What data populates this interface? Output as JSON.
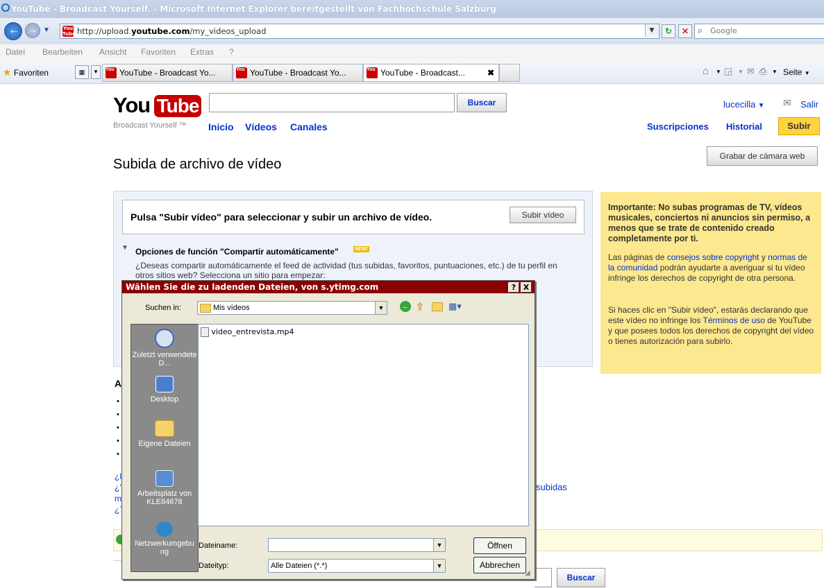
{
  "browser": {
    "title": "YouTube - Broadcast Yourself. - Microsoft Internet Explorer bereitgestellt von Fachhochschule Salzburg",
    "url_prefix": "http://upload.",
    "url_domain": "youtube.com",
    "url_path": "/my_videos_upload",
    "search_placeholder": "Google",
    "menu": [
      "Datei",
      "Bearbeiten",
      "Ansicht",
      "Favoriten",
      "Extras",
      "?"
    ],
    "favorites_label": "Favoriten",
    "tabs": [
      "YouTube - Broadcast Yo...",
      "YouTube - Broadcast Yo...",
      "YouTube - Broadcast..."
    ],
    "tools_page": "Seite"
  },
  "youtube": {
    "logo_you": "You",
    "logo_tube": "Tube",
    "tagline": "Broadcast Yourself ™",
    "search_button": "Buscar",
    "nav": [
      "Inicio",
      "Vídeos",
      "Canales"
    ],
    "user": "lucecilla",
    "logout": "Salir",
    "subscriptions": "Suscripciones",
    "history": "Historial",
    "upload": "Subir",
    "webcam_button": "Grabar de cámara web",
    "page_title": "Subida de archivo de vídeo",
    "upload_prompt": "Pulsa \"Subir vídeo\" para seleccionar y subir un archivo de vídeo.",
    "upload_button": "Subir vídeo",
    "autoshare_title": "Opciones de función \"Compartir automáticamente\"",
    "new_badge": "NEW!",
    "autoshare_text": "¿Deseas compartir automáticamente el feed de actividad (tus subidas, favoritos, puntuaciones, etc.) de tu perfil en otros sitios web? Selecciona un sitio para empezar:",
    "partial_a": "A",
    "partial_lines": [
      "¿l",
      "¿'",
      "m",
      "¿T"
    ],
    "partial_subidas": "subidas",
    "bottom_search_button": "Buscar",
    "warning": {
      "heading": "Importante: No subas programas de TV, vídeos musicales, conciertos ni anuncios sin permiso, a menos que se trate de contenido creado completamente por ti.",
      "p1_a": "Las páginas de ",
      "p1_link1": "consejos sobre copyright",
      "p1_b": " y ",
      "p1_link2": "normas de la comunidad",
      "p1_c": " podrán ayudarte a averiguar si tu vídeo infringe los derechos de copyright de otra persona.",
      "p2_a": "Si haces clic en \"Subir vídeo\", estarás declarando que este vídeo no infringe los ",
      "p2_link": "Términos de uso",
      "p2_b": " de YouTube y que posees todos los derechos de copyright del vídeo o tienes autorización para subirlo."
    }
  },
  "dialog": {
    "title": "Wählen Sie die zu ladenden Dateien, von s.ytimg.com",
    "help_btn": "?",
    "close_btn": "X",
    "lookin_label": "Suchen in:",
    "lookin_value": "Mis vídeos",
    "places": [
      "Zuletzt verwendete D...",
      "Desktop",
      "Eigene Dateien",
      "Arbeitsplatz von KLE84678",
      "Netzwerkumgebung"
    ],
    "files": [
      "video_entrevista.mp4"
    ],
    "filename_label": "Dateiname:",
    "filename_value": "",
    "filetype_label": "Dateityp:",
    "filetype_value": "Alle Dateien (*.*)",
    "open_button": "Öffnen",
    "cancel_button": "Abbrechen"
  }
}
